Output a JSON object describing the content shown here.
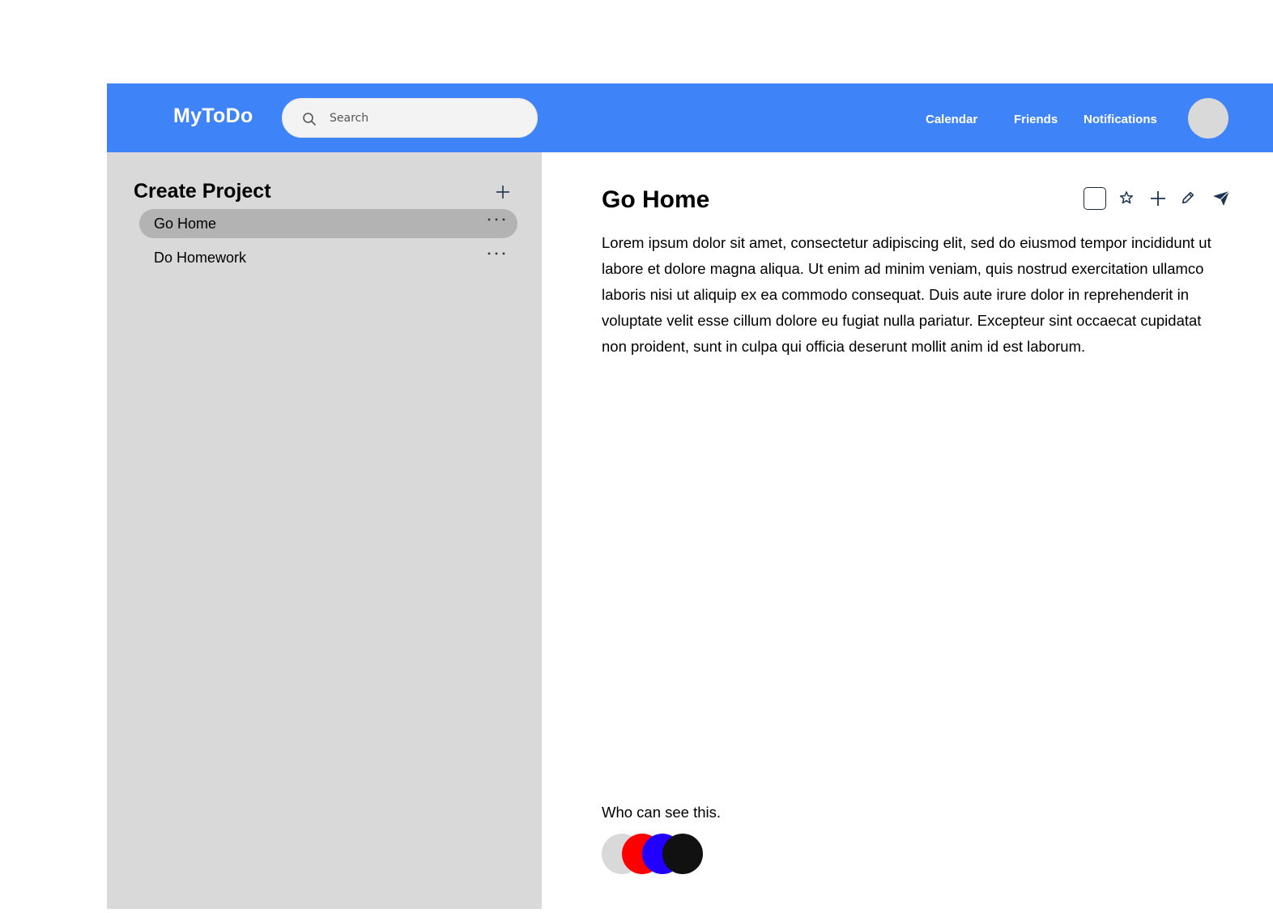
{
  "header": {
    "brand": "MyToDo",
    "search": {
      "placeholder": "Search"
    },
    "nav": {
      "calendar": "Calendar",
      "friends": "Friends",
      "notifications": "Notifications"
    }
  },
  "sidebar": {
    "create_label": "Create Project",
    "projects": [
      {
        "label": "Go Home",
        "active": true
      },
      {
        "label": "Do Homework",
        "active": false
      }
    ]
  },
  "task": {
    "title": "Go Home",
    "description": "Lorem ipsum dolor sit amet, consectetur adipiscing elit, sed do eiusmod tempor incididunt ut labore et dolore magna aliqua. Ut enim ad minim veniam, quis nostrud exercitation ullamco laboris nisi ut aliquip ex ea commodo consequat. Duis aute irure dolor in reprehenderit in voluptate velit esse cillum dolore eu fugiat nulla pariatur. Excepteur sint occaecat cupidatat non proident, sunt in culpa qui officia deserunt mollit anim id est laborum.",
    "toolbar_icons": [
      "checkbox-icon",
      "star-icon",
      "plus-icon",
      "pencil-icon",
      "send-icon"
    ]
  },
  "visibility": {
    "label": "Who can see this.",
    "viewer_colors": [
      "#d9d9d9",
      "#ff0000",
      "#2200ff",
      "#111111"
    ]
  },
  "colors": {
    "header": "#3f83f8",
    "sidebar": "#d9d9d9",
    "active_item": "#b3b3b3",
    "icon": "#1c3550"
  }
}
